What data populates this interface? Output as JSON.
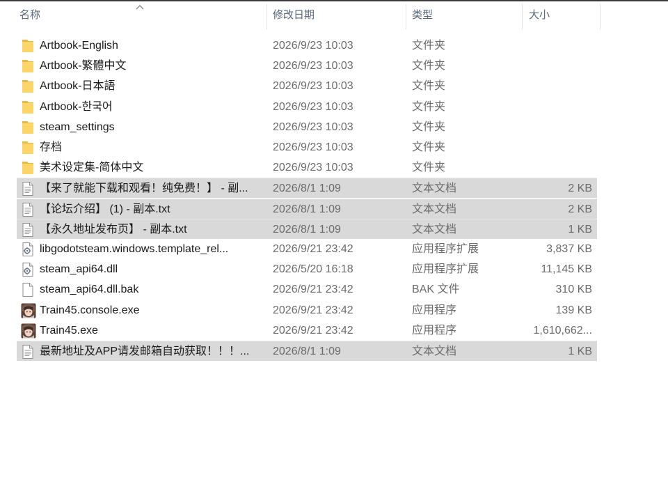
{
  "header": {
    "columns": [
      {
        "key": "name",
        "label": "名称"
      },
      {
        "key": "date",
        "label": "修改日期"
      },
      {
        "key": "type",
        "label": "类型"
      },
      {
        "key": "size",
        "label": "大小"
      }
    ],
    "sort_icon": "chevron-up-icon"
  },
  "colors": {
    "selection": "#d9d9d9",
    "folder": "#fbd46a",
    "secondary_text": "#6b6b6b"
  },
  "rows": [
    {
      "icon": "folder-icon",
      "name": "Artbook-English",
      "date": "2026/9/23 10:03",
      "type": "文件夹",
      "size": "",
      "selected": false
    },
    {
      "icon": "folder-icon",
      "name": "Artbook-繁體中文",
      "date": "2026/9/23 10:03",
      "type": "文件夹",
      "size": "",
      "selected": false
    },
    {
      "icon": "folder-icon",
      "name": "Artbook-日本語",
      "date": "2026/9/23 10:03",
      "type": "文件夹",
      "size": "",
      "selected": false
    },
    {
      "icon": "folder-icon",
      "name": "Artbook-한국어",
      "date": "2026/9/23 10:03",
      "type": "文件夹",
      "size": "",
      "selected": false
    },
    {
      "icon": "folder-icon",
      "name": "steam_settings",
      "date": "2026/9/23 10:03",
      "type": "文件夹",
      "size": "",
      "selected": false
    },
    {
      "icon": "folder-icon",
      "name": "存档",
      "date": "2026/9/23 10:03",
      "type": "文件夹",
      "size": "",
      "selected": false
    },
    {
      "icon": "folder-icon",
      "name": "美术设定集-简体中文",
      "date": "2026/9/23 10:03",
      "type": "文件夹",
      "size": "",
      "selected": false
    },
    {
      "icon": "text-file-icon",
      "name": "【来了就能下载和观看！纯免费！】 - 副...",
      "date": "2026/8/1 1:09",
      "type": "文本文档",
      "size": "2 KB",
      "selected": true
    },
    {
      "icon": "text-file-icon",
      "name": "【论坛介绍】 (1) - 副本.txt",
      "date": "2026/8/1 1:09",
      "type": "文本文档",
      "size": "2 KB",
      "selected": true
    },
    {
      "icon": "text-file-icon",
      "name": "【永久地址发布页】 - 副本.txt",
      "date": "2026/8/1 1:09",
      "type": "文本文档",
      "size": "1 KB",
      "selected": true
    },
    {
      "icon": "dll-file-icon",
      "name": "libgodotsteam.windows.template_rel...",
      "date": "2026/9/21 23:42",
      "type": "应用程序扩展",
      "size": "3,837 KB",
      "selected": false
    },
    {
      "icon": "dll-file-icon",
      "name": "steam_api64.dll",
      "date": "2026/5/20 16:18",
      "type": "应用程序扩展",
      "size": "11,145 KB",
      "selected": false
    },
    {
      "icon": "blank-file-icon",
      "name": "steam_api64.dll.bak",
      "date": "2026/9/21 23:42",
      "type": "BAK 文件",
      "size": "310 KB",
      "selected": false
    },
    {
      "icon": "app-exe-icon",
      "name": "Train45.console.exe",
      "date": "2026/9/21 23:42",
      "type": "应用程序",
      "size": "139 KB",
      "selected": false
    },
    {
      "icon": "app-exe-icon",
      "name": "Train45.exe",
      "date": "2026/9/21 23:42",
      "type": "应用程序",
      "size": "1,610,662...",
      "selected": false
    },
    {
      "icon": "text-file-icon",
      "name": "最新地址及APP请发邮箱自动获取！！！...",
      "date": "2026/8/1 1:09",
      "type": "文本文档",
      "size": "1 KB",
      "selected": true
    }
  ]
}
